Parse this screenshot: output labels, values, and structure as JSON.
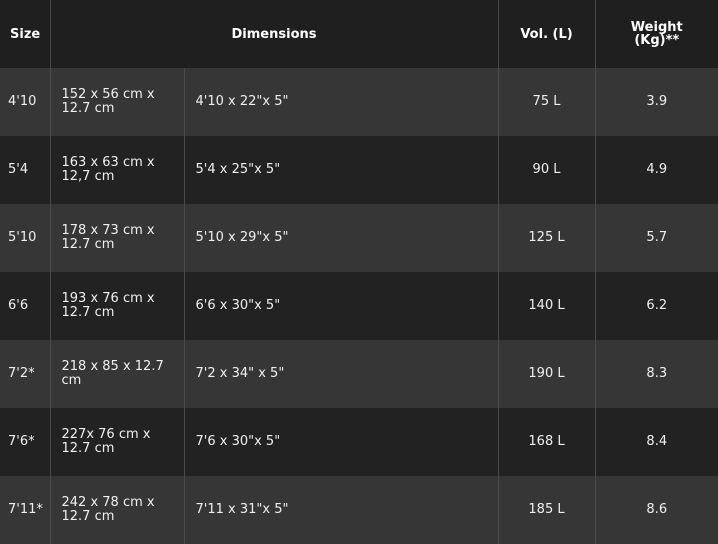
{
  "headers": {
    "size": "Size",
    "dimensions": "Dimensions",
    "volume": "Vol. (L)",
    "weight_line1": "Weight",
    "weight_line2": "(Kg)**"
  },
  "rows": [
    {
      "size": "4'10",
      "metric": "152 x 56 cm x 12.7 cm",
      "imperial": "4'10 x 22\"x 5\"",
      "volume": "75 L",
      "weight": "3.9"
    },
    {
      "size": "5'4",
      "metric": "163 x 63 cm x 12,7 cm",
      "imperial": "5'4 x 25\"x 5\"",
      "volume": "90 L",
      "weight": "4.9"
    },
    {
      "size": "5'10",
      "metric": "178 x 73 cm x 12.7 cm",
      "imperial": "5'10 x 29\"x 5\"",
      "volume": "125 L",
      "weight": "5.7"
    },
    {
      "size": "6'6",
      "metric": "193 x 76 cm x 12.7 cm",
      "imperial": "6'6 x 30\"x 5\"",
      "volume": "140 L",
      "weight": "6.2"
    },
    {
      "size": "7'2*",
      "metric": "218 x 85 x 12.7 cm",
      "imperial": "7'2 x 34\" x 5\"",
      "volume": "190 L",
      "weight": "8.3"
    },
    {
      "size": "7'6*",
      "metric": "227x 76 cm x 12.7 cm",
      "imperial": "7'6 x 30\"x 5\"",
      "volume": "168 L",
      "weight": "8.4"
    },
    {
      "size": "7'11*",
      "metric": "242 x 78 cm x 12.7 cm",
      "imperial": "7'11 x 31\"x 5\"",
      "volume": "185 L",
      "weight": "8.6"
    }
  ]
}
